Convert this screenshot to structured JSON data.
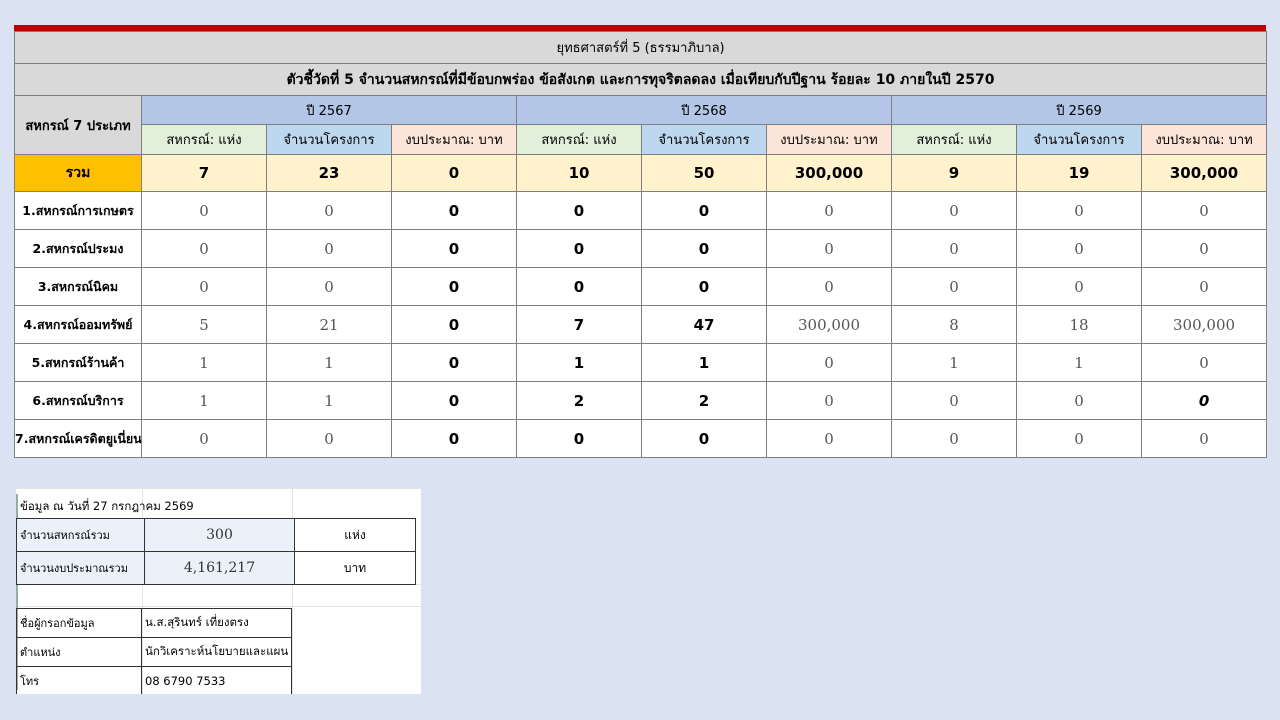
{
  "strategy_title": "ยุทธศาสตร์ที่ 5 (ธรรมาภิบาล)",
  "indicator_title": "ตัวชี้วัดที่ 5 จำนวนสหกรณ์ที่มีข้อบกพร่อง ข้อสังเกต และการทุจริตลดลง เมื่อเทียบกับปีฐาน ร้อยละ 10 ภายในปี 2570",
  "category_header": "สหกรณ์ 7 ประเภท",
  "years": [
    "ปี 2567",
    "ปี 2568",
    "ปี 2569"
  ],
  "sub_headers": [
    "สหกรณ์: แห่ง",
    "จำนวนโครงการ",
    "งบประมาณ: บาท"
  ],
  "total_label": "รวม",
  "total_values": [
    "7",
    "23",
    "0",
    "10",
    "50",
    "300,000",
    "9",
    "19",
    "300,000"
  ],
  "rows": [
    {
      "label": "1.สหกรณ์การเกษตร",
      "values": [
        "0",
        "0",
        "0",
        "0",
        "0",
        "0",
        "0",
        "0",
        "0"
      ]
    },
    {
      "label": "2.สหกรณ์ประมง",
      "values": [
        "0",
        "0",
        "0",
        "0",
        "0",
        "0",
        "0",
        "0",
        "0"
      ]
    },
    {
      "label": "3.สหกรณ์นิคม",
      "values": [
        "0",
        "0",
        "0",
        "0",
        "0",
        "0",
        "0",
        "0",
        "0"
      ]
    },
    {
      "label": "4.สหกรณ์ออมทรัพย์",
      "values": [
        "5",
        "21",
        "0",
        "7",
        "47",
        "300,000",
        "8",
        "18",
        "300,000"
      ]
    },
    {
      "label": "5.สหกรณ์ร้านค้า",
      "values": [
        "1",
        "1",
        "0",
        "1",
        "1",
        "0",
        "1",
        "1",
        "0"
      ]
    },
    {
      "label": "6.สหกรณ์บริการ",
      "values": [
        "1",
        "1",
        "0",
        "2",
        "2",
        "0",
        "0",
        "0",
        "0"
      ]
    },
    {
      "label": "7.สหกรณ์เครดิตยูเนี่ยน",
      "values": [
        "0",
        "0",
        "0",
        "0",
        "0",
        "0",
        "0",
        "0",
        "0"
      ]
    }
  ],
  "summary": {
    "date_line": "ข้อมูล ณ วันที่  27 กรกฎาคม 2569",
    "coop_total_label": "จำนวนสหกรณ์รวม",
    "coop_total_value": "300",
    "coop_total_unit": "แห่ง",
    "budget_total_label": "จำนวนงบประมาณรวม",
    "budget_total_value": "4,161,217",
    "budget_total_unit": "บาท"
  },
  "contact": {
    "name_label": "ชื่อผู้กรอกข้อมูล",
    "name_value": "น.ส.สุรินทร์ เที่ยงตรง",
    "position_label": "ตำแหน่ง",
    "position_value": "นักวิเคราะห์นโยบายและแผน",
    "phone_label": "โทร",
    "phone_value": "08 6790 7533"
  }
}
